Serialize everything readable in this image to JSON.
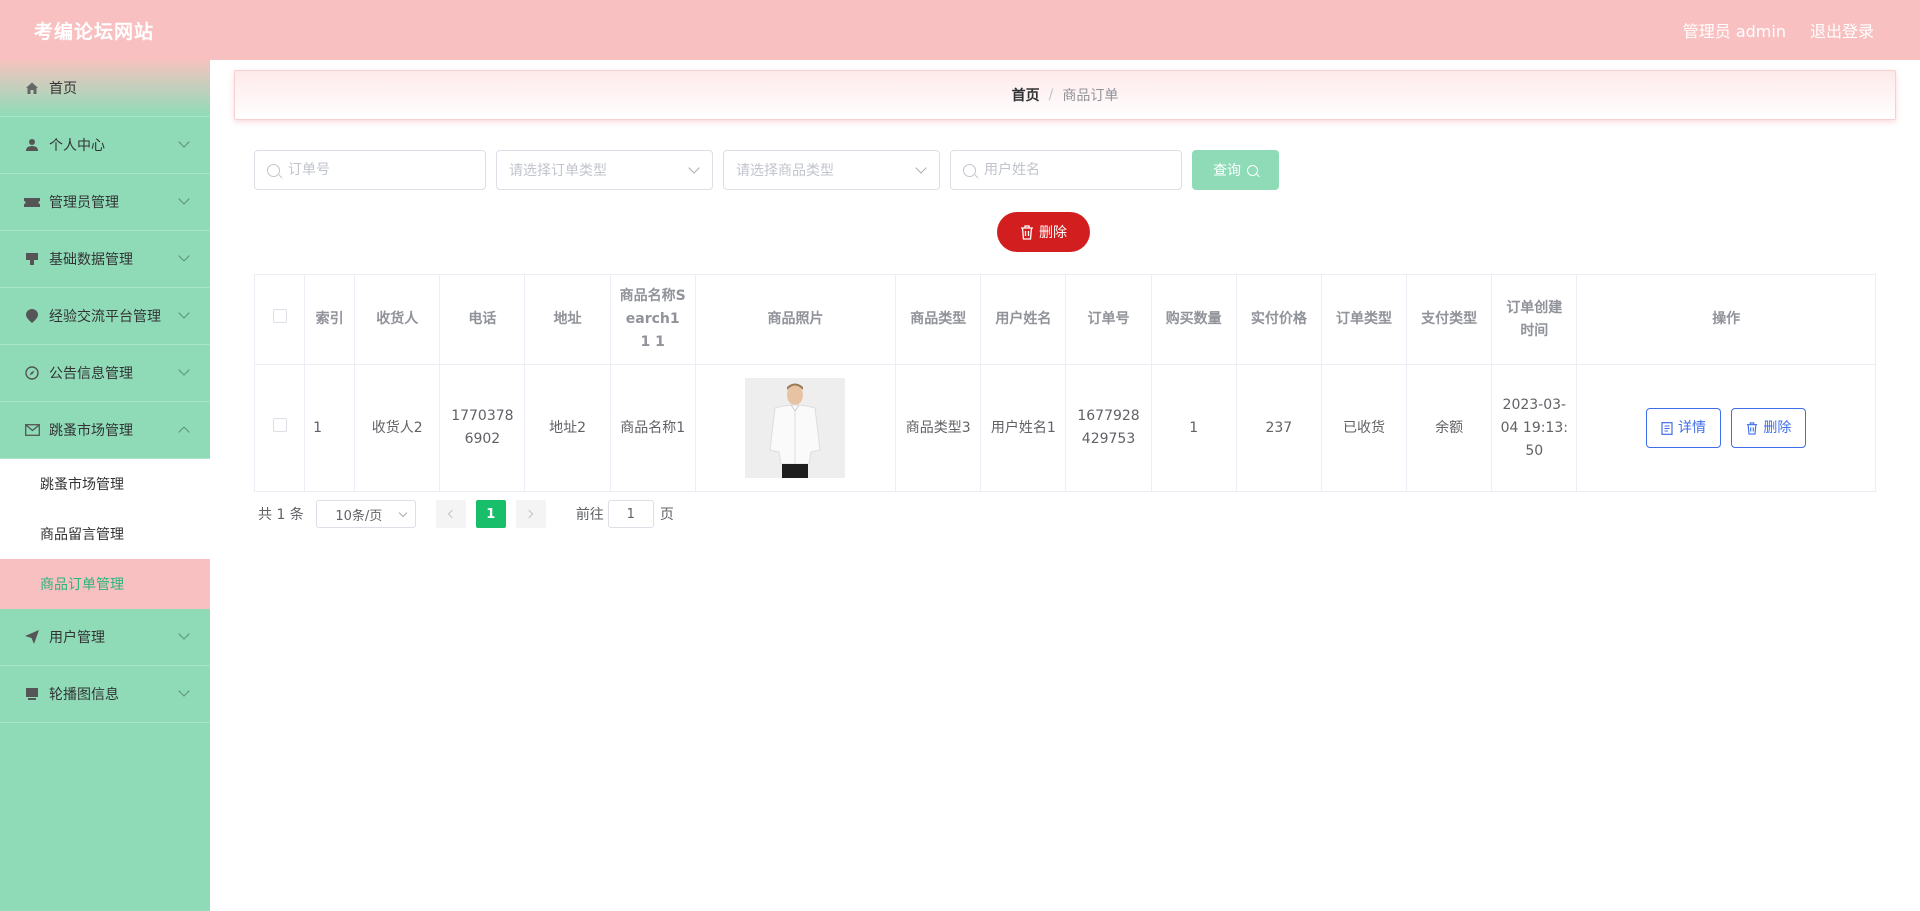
{
  "header": {
    "site_title": "考编论坛网站",
    "admin_label": "管理员 admin",
    "logout_label": "退出登录"
  },
  "sidebar": {
    "items": [
      {
        "label": "首页",
        "icon": "home-icon"
      },
      {
        "label": "个人中心",
        "icon": "user-icon"
      },
      {
        "label": "管理员管理",
        "icon": "ticket-icon"
      },
      {
        "label": "基础数据管理",
        "icon": "data-icon"
      },
      {
        "label": "经验交流平台管理",
        "icon": "location-icon"
      },
      {
        "label": "公告信息管理",
        "icon": "compass-icon"
      },
      {
        "label": "跳蚤市场管理",
        "icon": "message-icon"
      },
      {
        "label": "用户管理",
        "icon": "send-icon"
      },
      {
        "label": "轮播图信息",
        "icon": "picture-icon"
      }
    ],
    "submenu": [
      {
        "label": "跳蚤市场管理"
      },
      {
        "label": "商品留言管理"
      },
      {
        "label": "商品订单管理"
      }
    ]
  },
  "breadcrumb": {
    "home": "首页",
    "separator": "/",
    "current": "商品订单"
  },
  "filters": {
    "order_no_placeholder": "订单号",
    "order_type_placeholder": "请选择订单类型",
    "goods_type_placeholder": "请选择商品类型",
    "user_name_placeholder": "用户姓名",
    "query_label": "查询"
  },
  "delete_label": "删除",
  "table": {
    "columns": [
      "索引",
      "收货人",
      "电话",
      "地址",
      "商品名称Search1 1 1",
      "商品照片",
      "商品类型",
      "用户姓名",
      "订单号",
      "购买数量",
      "实付价格",
      "订单类型",
      "支付类型",
      "订单创建时间",
      "操作"
    ],
    "rows": [
      {
        "index": "1",
        "receiver": "收货人2",
        "phone": "17703786902",
        "address": "地址2",
        "goods_name": "商品名称1",
        "goods_type": "商品类型3",
        "user_name": "用户姓名1",
        "order_no": "1677928429753",
        "quantity": "1",
        "price": "237",
        "order_type": "已收货",
        "pay_type": "余额",
        "created": "2023-03-04 19:13:50",
        "detail_label": "详情",
        "delete_label": "删除"
      }
    ]
  },
  "pagination": {
    "total": "共 1 条",
    "page_size": "10条/页",
    "current_page": "1",
    "goto_label": "前往",
    "goto_value": "1",
    "page_suffix": "页"
  },
  "colors": {
    "header": "#f8c0c0",
    "sidebar": "#8fdbb8",
    "danger": "#d21e1e",
    "primary": "#3f6ee8",
    "page_active": "#19be6b"
  }
}
